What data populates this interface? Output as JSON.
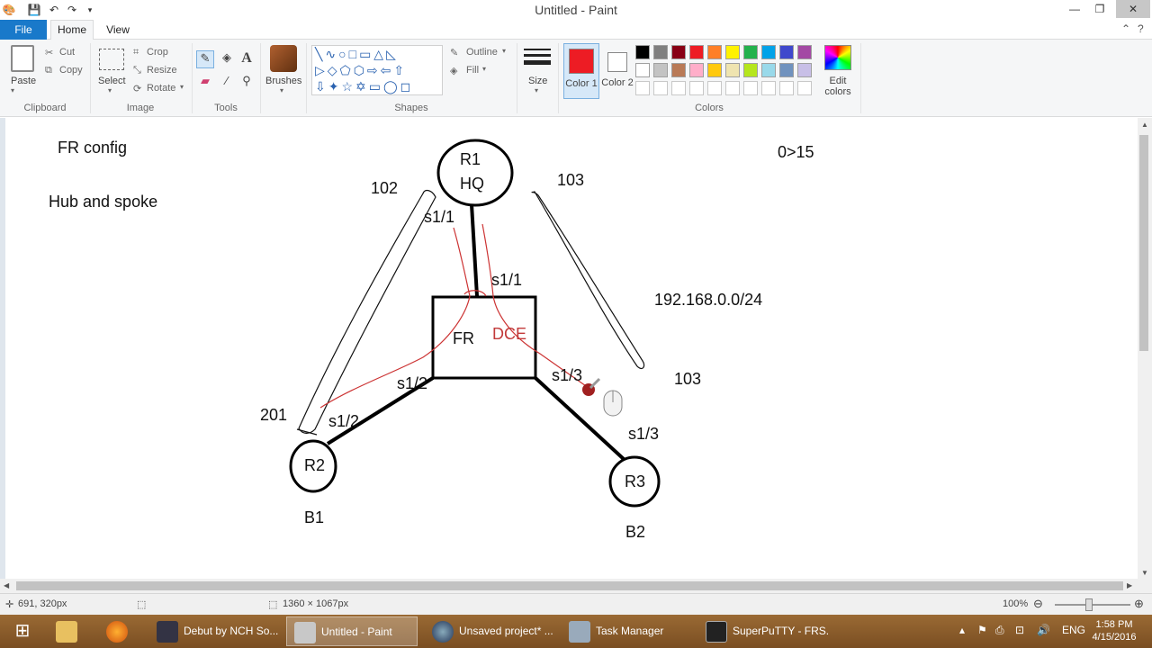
{
  "window": {
    "title": "Untitled - Paint",
    "minimize_glyph": "—",
    "maximize_glyph": "❐",
    "close_glyph": "✕"
  },
  "quick_access": [
    "paint-icon",
    "save-icon",
    "undo-icon",
    "redo-icon",
    "customize-icon"
  ],
  "tabs": {
    "file": "File",
    "home": "Home",
    "view": "View"
  },
  "ribbon": {
    "clipboard": {
      "paste": "Paste",
      "cut": "Cut",
      "copy": "Copy",
      "label": "Clipboard"
    },
    "image": {
      "select": "Select",
      "crop": "Crop",
      "resize": "Resize",
      "rotate": "Rotate",
      "label": "Image"
    },
    "tools": {
      "label": "Tools"
    },
    "brushes": {
      "label": "Brushes"
    },
    "shapes": {
      "outline": "Outline",
      "fill": "Fill",
      "label": "Shapes"
    },
    "size": {
      "label": "Size"
    },
    "colors": {
      "color1": "Color 1",
      "color2": "Color 2",
      "edit": "Edit colors",
      "label": "Colors",
      "color1_value": "#ed1c24",
      "color2_value": "#ffffff",
      "palette_row1": [
        "#000000",
        "#7f7f7f",
        "#880015",
        "#ed1c24",
        "#ff7f27",
        "#fff200",
        "#22b14c",
        "#00a2e8",
        "#3f48cc",
        "#a349a4"
      ],
      "palette_row2": [
        "#ffffff",
        "#c3c3c3",
        "#b97a57",
        "#ffaec9",
        "#ffc90e",
        "#efe4b0",
        "#b5e61d",
        "#99d9ea",
        "#7092be",
        "#c8bfe7"
      ]
    }
  },
  "canvas": {
    "labels": {
      "fr_config": "FR config",
      "hub_spoke": "Hub and spoke",
      "range": "0>15",
      "subnet": "192.168.0.0/24",
      "r1": "R1",
      "hq": "HQ",
      "fr": "FR",
      "dce": "DCE",
      "r2": "R2",
      "b1": "B1",
      "r3": "R3",
      "b2": "B2",
      "dlci_102": "102",
      "dlci_103_top": "103",
      "dlci_103_right": "103",
      "dlci_201": "201",
      "s11_a": "s1/1",
      "s11_b": "s1/1",
      "s12_a": "s1/2",
      "s12_b": "s1/2",
      "s13_a": "s1/3",
      "s13_b": "s1/3"
    }
  },
  "status": {
    "cursor_pos": "691, 320px",
    "canvas_size": "1360 × 1067px",
    "zoom": "100%"
  },
  "taskbar": {
    "items": [
      "Debut by NCH So...",
      "Untitled - Paint",
      "Unsaved project* ...",
      "Task Manager",
      "SuperPuTTY - FRS..."
    ],
    "language": "ENG",
    "time": "1:58 PM",
    "date": "4/15/2016"
  }
}
